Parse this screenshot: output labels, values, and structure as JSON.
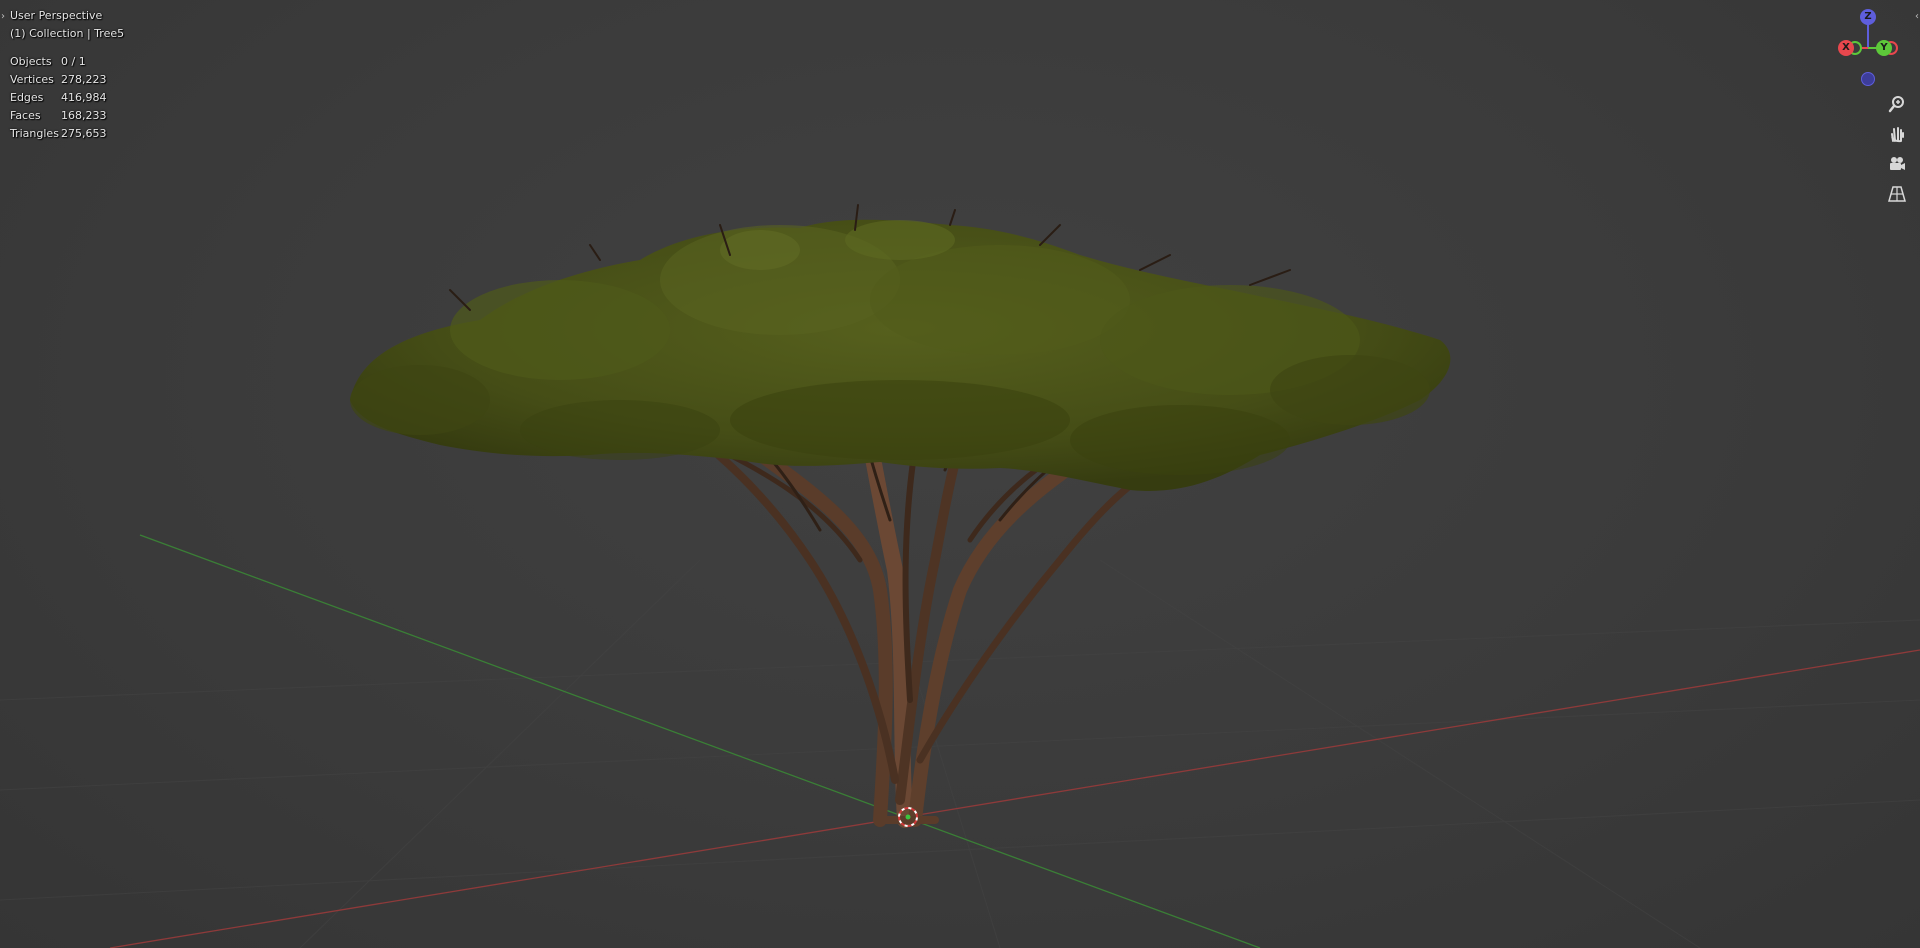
{
  "viewport": {
    "view_name": "User Perspective",
    "collection_line": "(1) Collection | Tree5",
    "stats": [
      {
        "label": "Objects",
        "value": "0 / 1"
      },
      {
        "label": "Vertices",
        "value": "278,223"
      },
      {
        "label": "Edges",
        "value": "416,984"
      },
      {
        "label": "Faces",
        "value": "168,233"
      },
      {
        "label": "Triangles",
        "value": "275,653"
      }
    ]
  },
  "gizmo": {
    "x_label": "X",
    "y_label": "Y",
    "z_label": "Z",
    "colors": {
      "x": "#e8474d",
      "y": "#5dc83a",
      "z": "#5e5edc",
      "neg_z": "#3d3d9a"
    }
  },
  "toolbar": {
    "zoom_icon": "zoom-icon",
    "pan_icon": "hand-pan-icon",
    "camera_icon": "camera-view-icon",
    "ortho_icon": "perspective-grid-icon"
  },
  "colors": {
    "background": "#3b3b3b",
    "x_axis": "#9a3d3d",
    "y_axis": "#3f8a3a",
    "foliage": "#4b5418",
    "trunk": "#5e3f2c"
  }
}
